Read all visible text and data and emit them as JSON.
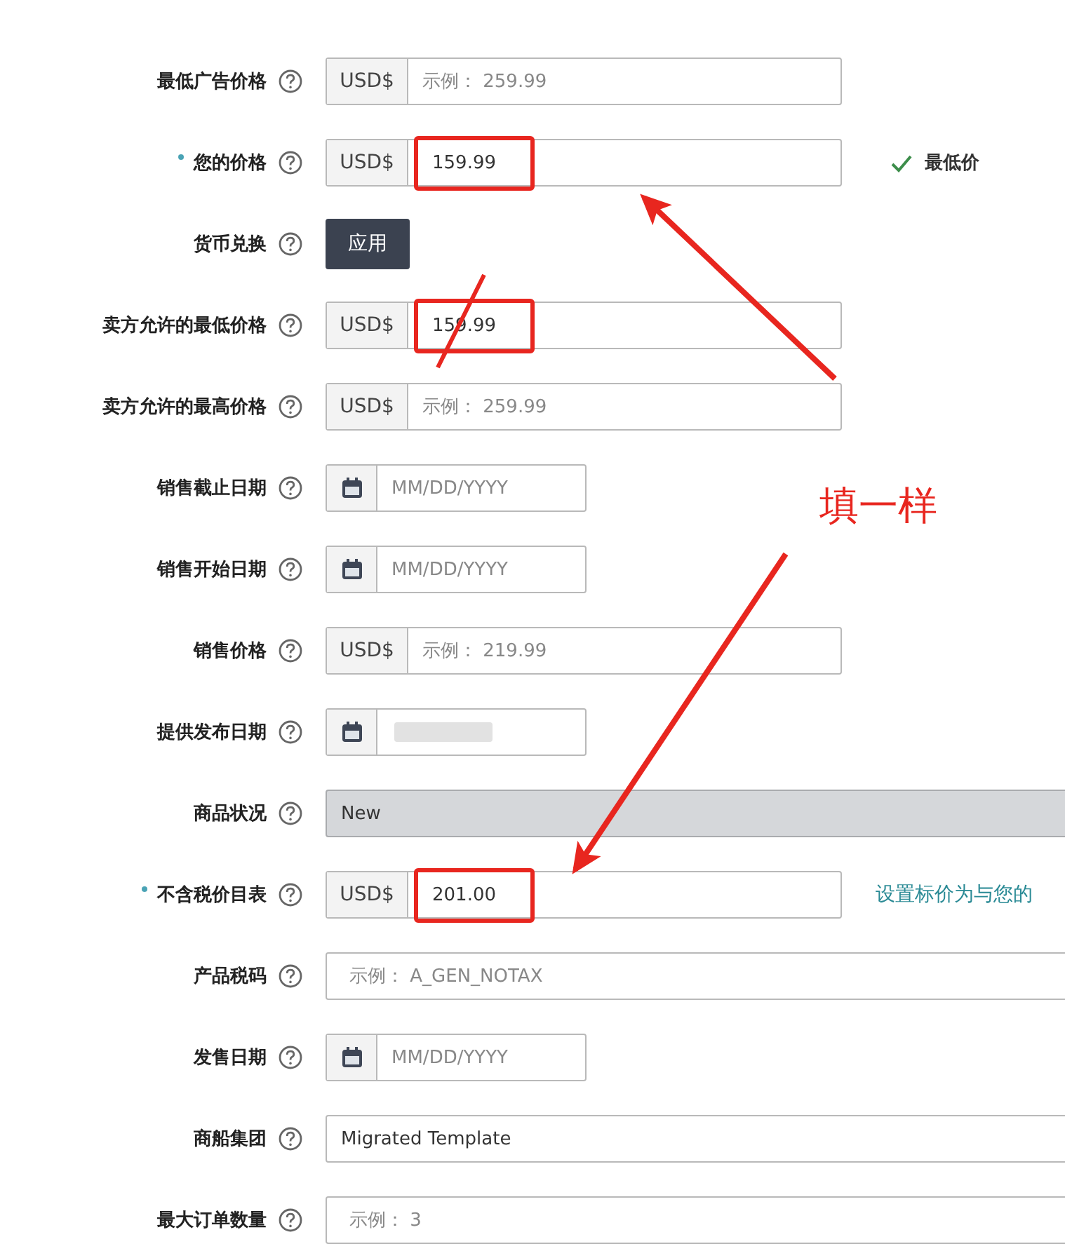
{
  "rows": [
    {
      "label": "最低广告价格",
      "required": false,
      "kind": "currency",
      "prefix": "USD$",
      "placeholder": "示例： 259.99"
    },
    {
      "label": "您的价格",
      "required": true,
      "kind": "currency",
      "prefix": "USD$",
      "value": "159.99",
      "highlighted": true,
      "note": {
        "kind": "check",
        "text": "最低价"
      }
    },
    {
      "label": "货币兑换",
      "required": false,
      "kind": "button",
      "button": "应用"
    },
    {
      "label": "卖方允许的最低价格",
      "required": false,
      "kind": "currency",
      "prefix": "USD$",
      "value": "159.99",
      "highlighted": true
    },
    {
      "label": "卖方允许的最高价格",
      "required": false,
      "kind": "currency",
      "prefix": "USD$",
      "placeholder": "示例： 259.99"
    },
    {
      "label": "销售截止日期",
      "required": false,
      "kind": "date",
      "placeholder": "MM/DD/YYYY"
    },
    {
      "label": "销售开始日期",
      "required": false,
      "kind": "date",
      "placeholder": "MM/DD/YYYY"
    },
    {
      "label": "销售价格",
      "required": false,
      "kind": "currency",
      "prefix": "USD$",
      "placeholder": "示例： 219.99"
    },
    {
      "label": "提供发布日期",
      "required": false,
      "kind": "date",
      "blurred": true
    },
    {
      "label": "商品状况",
      "required": false,
      "kind": "select",
      "value": "New"
    },
    {
      "label": "不含税价目表",
      "required": true,
      "kind": "currency",
      "prefix": "USD$",
      "value": "201.00",
      "highlighted": true,
      "note": {
        "kind": "link",
        "text": "设置标价为与您的"
      }
    },
    {
      "label": "产品税码",
      "required": false,
      "kind": "text",
      "placeholder": "示例： A_GEN_NOTAX"
    },
    {
      "label": "发售日期",
      "required": false,
      "kind": "date",
      "placeholder": "MM/DD/YYYY"
    },
    {
      "label": "商船集团",
      "required": false,
      "kind": "text",
      "value": "Migrated Template"
    },
    {
      "label": "最大订单数量",
      "required": false,
      "kind": "text",
      "placeholder": "示例： 3"
    }
  ],
  "annotation": {
    "text": "填一样"
  }
}
